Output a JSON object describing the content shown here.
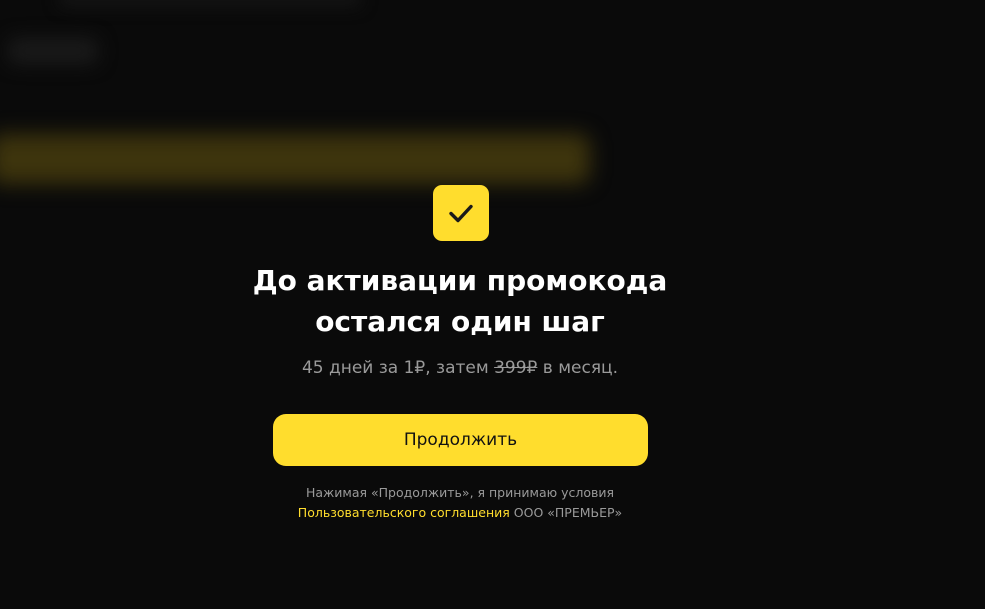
{
  "modal": {
    "title_line1": "До активации промокода",
    "title_line2": "остался один шаг",
    "subtitle_prefix": "45 дней за 1₽, затем ",
    "subtitle_price_old": "399₽",
    "subtitle_suffix": " в месяц.",
    "continue_label": "Продолжить",
    "terms_prefix": "Нажимая «Продолжить», я принимаю условия",
    "terms_link": "Пользовательского соглашения",
    "terms_suffix": " ООО «ПРЕМЬЕР»"
  },
  "icons": {
    "success": "checkmark-icon"
  },
  "colors": {
    "background": "#0a0a0a",
    "accent": "#ffdd2d",
    "text_primary": "#ffffff",
    "text_secondary": "#9a9a9a"
  }
}
